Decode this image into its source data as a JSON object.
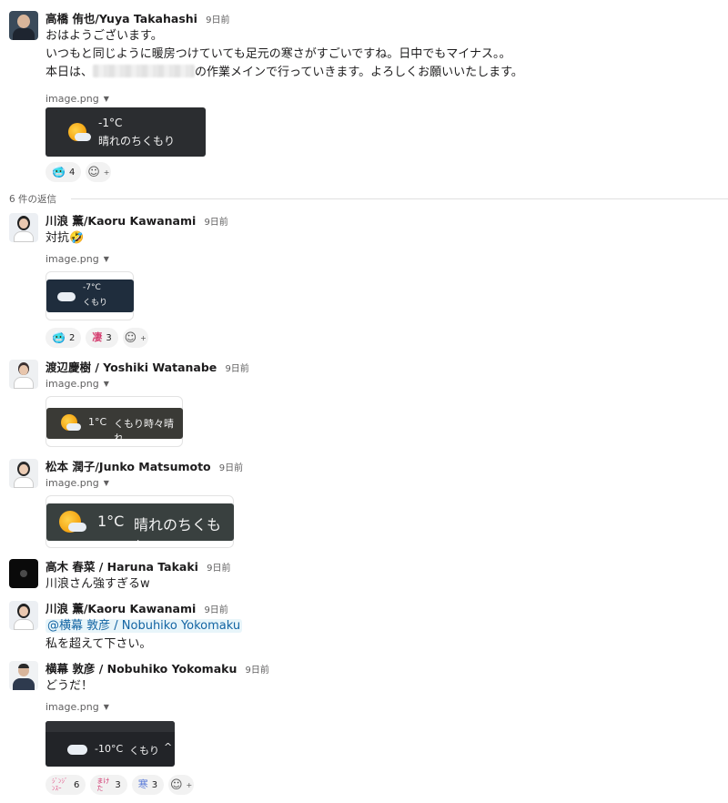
{
  "parent": {
    "author": "高橋 侑也/Yuya Takahashi",
    "time": "9日前",
    "lines": [
      "おはようございます。",
      "いつもと同じように暖房つけていても足元の寒さがすごいですね。日中でもマイナス。。"
    ],
    "line3_prefix": "本日は、",
    "line3_suffix": "の作業メインで行っていきます。よろしくお願いいたします。",
    "file_name": "image.png",
    "weather_temp": "-1°C",
    "weather_desc": "晴れのちくもり",
    "reactions": [
      {
        "emoji": "🥶",
        "count": "4"
      }
    ]
  },
  "reply_count": "6 件の返信",
  "replies": [
    {
      "author": "川浪 薫/Kaoru Kawanami",
      "time": "9日前",
      "text": "対抗🤣",
      "file_name": "image.png",
      "weather_temp": "-7°C",
      "weather_desc": "くもり",
      "reactions": [
        {
          "emoji": "🥶",
          "count": "2"
        },
        {
          "emoji": "凄",
          "count": "3"
        }
      ]
    },
    {
      "author": "渡辺慶樹 / Yoshiki Watanabe",
      "time": "9日前",
      "file_name": "image.png",
      "weather_temp": "1°C",
      "weather_desc": "くもり時々晴れ"
    },
    {
      "author": "松本 潤子/Junko Matsumoto",
      "time": "9日前",
      "file_name": "image.png",
      "weather_temp": "1°C",
      "weather_desc": "晴れのちくもり"
    },
    {
      "author": "高木 春菜 / Haruna Takaki",
      "time": "9日前",
      "text": "川浪さん強すぎるw"
    },
    {
      "author": "川浪 薫/Kaoru Kawanami",
      "time": "9日前",
      "mention": "@横幕 敦彦 / Nobuhiko Yokomaku",
      "text": "私を超えて下さい。"
    },
    {
      "author": "横幕 敦彦 / Nobuhiko Yokomaku",
      "time": "9日前",
      "text": "どうだ！",
      "file_name": "image.png",
      "weather_temp": "-10°C",
      "weather_desc": "くもり",
      "reactions": [
        {
          "emoji": "ｼﾞﾝｼﾞﾝｽｰ",
          "count": "6"
        },
        {
          "emoji": "まけた",
          "count": "3"
        },
        {
          "emoji": "寒",
          "count": "3"
        }
      ]
    }
  ],
  "icons": {
    "add_reaction": "add-reaction-icon",
    "dropdown": "caret-down-icon",
    "chevron_up": "chevron-up-icon"
  },
  "colors": {
    "mention_bg": "#e8f5fa",
    "mention_fg": "#1264a3",
    "weather_bg": "#2b2d30"
  }
}
